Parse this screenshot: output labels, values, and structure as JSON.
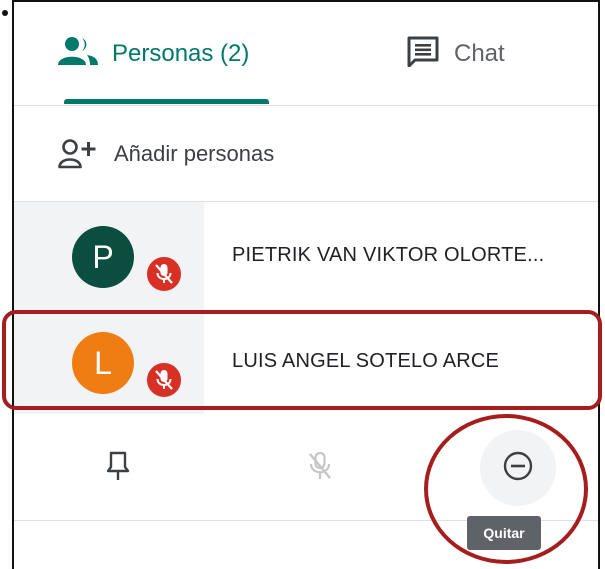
{
  "tabs": {
    "people_label": "Personas (2)",
    "chat_label": "Chat"
  },
  "add_people": {
    "label": "Añadir personas"
  },
  "participants": [
    {
      "initial": "P",
      "name": "PIETRIK VAN VIKTOR OLORTE...",
      "avatar_color": "#0b4d3e",
      "mic": "muted"
    },
    {
      "initial": "L",
      "name": "LUIS ANGEL SOTELO ARCE",
      "avatar_color": "#ef7d12",
      "mic": "muted"
    }
  ],
  "actions": {
    "pin_icon": "pin-icon",
    "mute_icon": "mic-off-icon",
    "remove_icon": "remove-circle-icon",
    "remove_tooltip": "Quitar"
  },
  "colors": {
    "accent": "#00796b",
    "muted_badge": "#d93025",
    "annotation": "#a51d1d"
  }
}
